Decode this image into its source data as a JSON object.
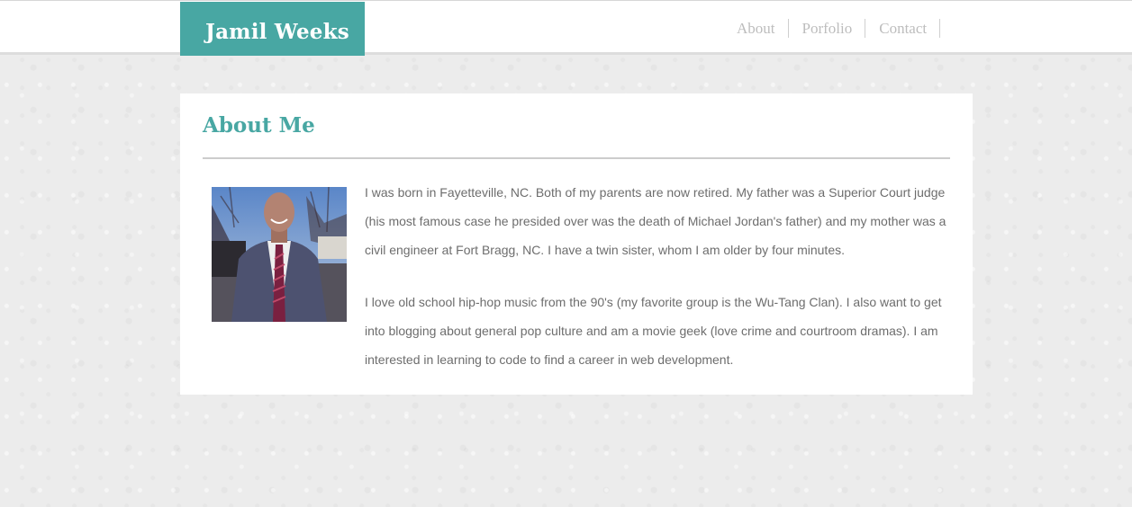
{
  "header": {
    "brand": "Jamil Weeks",
    "nav": [
      {
        "label": "About"
      },
      {
        "label": "Porfolio"
      },
      {
        "label": "Contact"
      }
    ]
  },
  "about": {
    "title": "About Me",
    "photo_alt": "portrait photo of man in suit",
    "paragraphs": [
      "I was born in Fayetteville, NC. Both of my parents are now retired. My father was a Superior Court judge (his most famous case he presided over was the death of Michael Jordan's father) and my mother was a civil engineer at Fort Bragg, NC. I have a twin sister, whom I am older by four minutes.",
      "I love old school hip-hop music from the 90's (my favorite group is the Wu-Tang Clan). I also want to get into blogging about general pop culture and am a movie geek (love crime and courtroom dramas). I am interested in learning to code to find a career in web development."
    ]
  },
  "colors": {
    "accent": "#48a7a3",
    "nav_text": "#bdbdbd",
    "body_text": "#6d6d6d",
    "background": "#ececec"
  }
}
